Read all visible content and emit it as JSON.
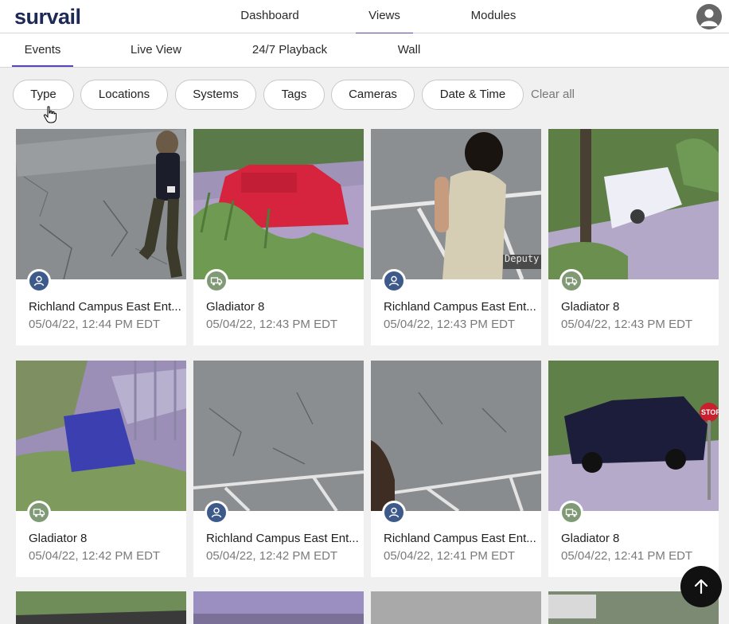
{
  "app": {
    "logo": "survail"
  },
  "top_nav": [
    {
      "label": "Dashboard",
      "active": false
    },
    {
      "label": "Views",
      "active": true
    },
    {
      "label": "Modules",
      "active": false
    }
  ],
  "sub_tabs": [
    {
      "label": "Events",
      "active": true
    },
    {
      "label": "Live View",
      "active": false
    },
    {
      "label": "24/7 Playback",
      "active": false
    },
    {
      "label": "Wall",
      "active": false
    }
  ],
  "filters": [
    {
      "label": "Type"
    },
    {
      "label": "Locations"
    },
    {
      "label": "Systems"
    },
    {
      "label": "Tags"
    },
    {
      "label": "Cameras"
    },
    {
      "label": "Date & Time"
    }
  ],
  "clear_all": "Clear all",
  "colors": {
    "accent": "#5a45b8",
    "person_badge": "#3d5a8a",
    "vehicle_badge": "#7f9a75"
  },
  "events": [
    {
      "camera": "Richland Campus East Ent...",
      "time": "05/04/22, 12:44 PM EDT",
      "type": "person",
      "icon": "person-icon"
    },
    {
      "camera": "Gladiator 8",
      "time": "05/04/22, 12:43 PM EDT",
      "type": "vehicle",
      "icon": "truck-icon"
    },
    {
      "camera": "Richland Campus East Ent...",
      "time": "05/04/22, 12:43 PM EDT",
      "type": "person",
      "icon": "person-icon",
      "overlay": "Deputy"
    },
    {
      "camera": "Gladiator 8",
      "time": "05/04/22, 12:43 PM EDT",
      "type": "vehicle",
      "icon": "truck-icon"
    },
    {
      "camera": "Gladiator 8",
      "time": "05/04/22, 12:42 PM EDT",
      "type": "vehicle",
      "icon": "truck-icon"
    },
    {
      "camera": "Richland Campus East Ent...",
      "time": "05/04/22, 12:42 PM EDT",
      "type": "person",
      "icon": "person-icon"
    },
    {
      "camera": "Richland Campus East Ent...",
      "time": "05/04/22, 12:41 PM EDT",
      "type": "person",
      "icon": "person-icon"
    },
    {
      "camera": "Gladiator 8",
      "time": "05/04/22, 12:41 PM EDT",
      "type": "vehicle",
      "icon": "truck-icon",
      "overlay": "STOP"
    }
  ]
}
